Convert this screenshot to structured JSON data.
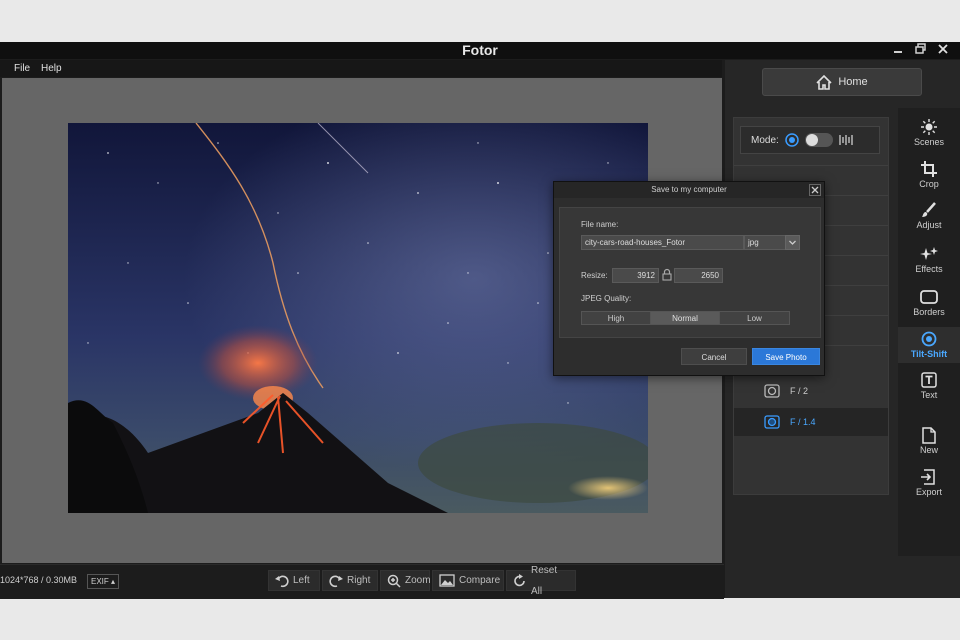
{
  "app": {
    "title": "Fotor",
    "window_controls": [
      "restore",
      "maximize",
      "close"
    ]
  },
  "menu": {
    "items": [
      {
        "label": "File"
      },
      {
        "label": "Help"
      }
    ]
  },
  "canvas": {
    "photo_description_icon": "volcano-night-sky-photo"
  },
  "status": {
    "image_info": "1024*768 / 0.30MB",
    "exif_label": "EXIF ▴"
  },
  "toolbar": {
    "left": "Left",
    "right": "Right",
    "zoom": "Zoom",
    "compare": "Compare",
    "reset_all": "Reset All"
  },
  "right_panel": {
    "home_label": "Home",
    "mode_label": "Mode:",
    "fstops": [
      {
        "label": "F / 2",
        "selected": false
      },
      {
        "label": "F / 1.4",
        "selected": true
      }
    ]
  },
  "sidebar": {
    "items": [
      {
        "label": "Scenes",
        "icon": "sun-icon"
      },
      {
        "label": "Crop",
        "icon": "crop-icon"
      },
      {
        "label": "Adjust",
        "icon": "brush-icon"
      },
      {
        "label": "Effects",
        "icon": "sparkle-icon"
      },
      {
        "label": "Borders",
        "icon": "border-icon"
      },
      {
        "label": "Tilt-Shift",
        "icon": "target-icon",
        "active": true
      },
      {
        "label": "Text",
        "icon": "text-icon"
      },
      {
        "label": "New",
        "icon": "new-file-icon"
      },
      {
        "label": "Export",
        "icon": "export-icon"
      }
    ]
  },
  "dialog": {
    "title": "Save to my computer",
    "file_name_label": "File name:",
    "file_name_value": "city-cars-road-houses_Fotor",
    "format_value": "jpg",
    "resize_label": "Resize:",
    "width_value": "3912",
    "height_value": "2650",
    "quality_label": "JPEG Quality:",
    "quality_options": [
      "High",
      "Normal",
      "Low"
    ],
    "quality_selected": "Normal",
    "cancel_label": "Cancel",
    "save_label": "Save Photo"
  },
  "colors": {
    "accent": "#2b78d8",
    "active_sidebar": "#4aa8ff"
  }
}
